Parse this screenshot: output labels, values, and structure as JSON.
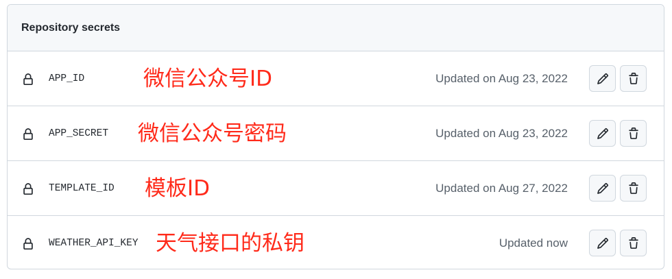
{
  "header": {
    "title": "Repository secrets"
  },
  "secrets": [
    {
      "name": "APP_ID",
      "annotation": "微信公众号ID",
      "updated": "Updated on Aug 23, 2022"
    },
    {
      "name": "APP_SECRET",
      "annotation": "微信公众号密码",
      "updated": "Updated on Aug 23, 2022"
    },
    {
      "name": "TEMPLATE_ID",
      "annotation": "模板ID",
      "updated": "Updated on Aug 27, 2022"
    },
    {
      "name": "WEATHER_API_KEY",
      "annotation": "天气接口的私钥",
      "updated": "Updated now"
    }
  ],
  "icons": {
    "lock": "lock-icon",
    "edit": "pencil-icon",
    "delete": "trash-icon"
  },
  "colors": {
    "annotation": "#ff2a1a",
    "border": "#d0d7de",
    "header_bg": "#f6f8fa",
    "muted_text": "#57606a"
  }
}
